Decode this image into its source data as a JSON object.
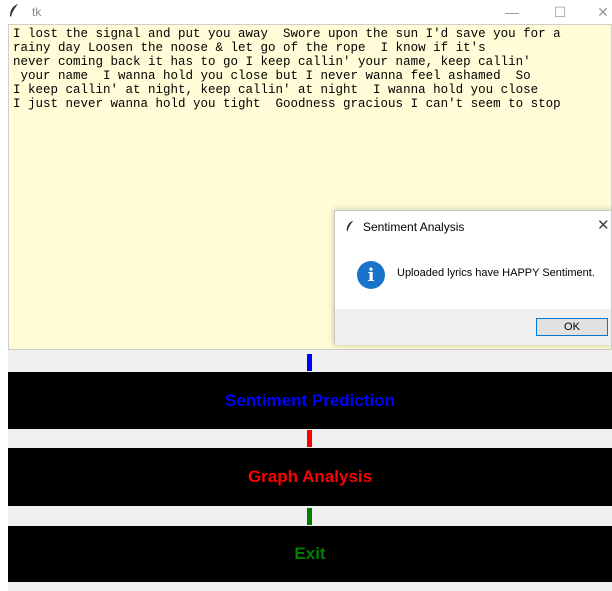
{
  "window": {
    "title": "tk"
  },
  "textarea": {
    "lines": [
      "I lost the signal and put you away  Swore upon the sun I'd save you for a",
      "rainy day Loosen the noose & let go of the rope  I know if it's",
      "never coming back it has to go I keep callin' your name, keep callin'",
      " your name  I wanna hold you close but I never wanna feel ashamed  So",
      "I keep callin' at night, keep callin' at night  I wanna hold you close",
      "I just never wanna hold you tight  Goodness gracious I can't seem to stop"
    ]
  },
  "buttons": {
    "sentiment": {
      "label": "Sentiment Prediction",
      "color": "#0000ff"
    },
    "graph": {
      "label": "Graph Analysis",
      "color": "#ff0000"
    },
    "exit": {
      "label": "Exit",
      "color": "#008000"
    }
  },
  "dialog": {
    "title": "Sentiment Analysis",
    "message": "Uploaded lyrics have HAPPY Sentiment.",
    "ok_label": "OK",
    "icon": "info-icon"
  },
  "colors": {
    "textarea_bg": "#fffcd7",
    "button_bg": "#000000",
    "gray_bg": "#f0f0f0"
  }
}
